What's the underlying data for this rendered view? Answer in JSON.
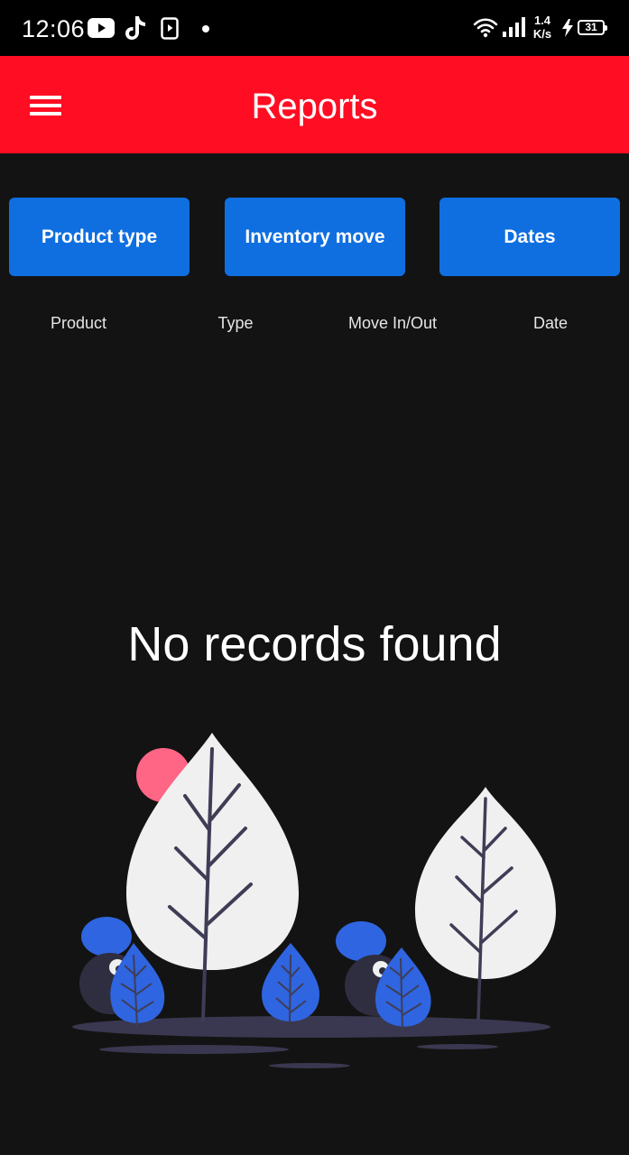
{
  "status_bar": {
    "time": "12:06",
    "net_speed_value": "1.4",
    "net_speed_unit": "K/s",
    "battery_level": "31",
    "icons": [
      "youtube-icon",
      "tiktok-icon",
      "media-icon",
      "dot-icon",
      "wifi-icon",
      "signal-icon",
      "charging-icon",
      "battery-icon"
    ]
  },
  "app_bar": {
    "title": "Reports",
    "menu_icon": "hamburger-menu-icon",
    "color": "#ff0d22"
  },
  "filters": {
    "product_type": "Product type",
    "inventory_move": "Inventory move",
    "dates": "Dates",
    "color": "#0f6fe0"
  },
  "table": {
    "columns": [
      "Product",
      "Type",
      "Move In/Out",
      "Date"
    ]
  },
  "empty_state": {
    "message": "No records found",
    "illustration": "plants-illustration"
  }
}
